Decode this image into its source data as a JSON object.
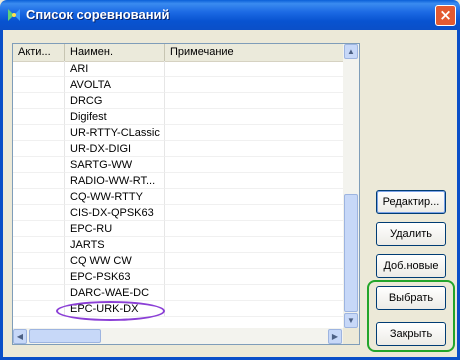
{
  "window": {
    "title": "Список соревнований",
    "close_label": "×"
  },
  "list": {
    "columns": [
      "Акти...",
      "Наимен.",
      "Примечание"
    ],
    "rows": [
      {
        "active": "",
        "name": "ARI",
        "note": ""
      },
      {
        "active": "",
        "name": "AVOLTA",
        "note": ""
      },
      {
        "active": "",
        "name": "DRCG",
        "note": ""
      },
      {
        "active": "",
        "name": "Digifest",
        "note": ""
      },
      {
        "active": "",
        "name": "UR-RTTY-CLassic",
        "note": ""
      },
      {
        "active": "",
        "name": "UR-DX-DIGI",
        "note": ""
      },
      {
        "active": "",
        "name": "SARTG-WW",
        "note": ""
      },
      {
        "active": "",
        "name": "RADIO-WW-RT...",
        "note": ""
      },
      {
        "active": "",
        "name": "CQ-WW-RTTY",
        "note": ""
      },
      {
        "active": "",
        "name": "CIS-DX-QPSK63",
        "note": ""
      },
      {
        "active": "",
        "name": "EPC-RU",
        "note": ""
      },
      {
        "active": "",
        "name": "JARTS",
        "note": ""
      },
      {
        "active": "",
        "name": "CQ WW CW",
        "note": ""
      },
      {
        "active": "",
        "name": "EPC-PSK63",
        "note": ""
      },
      {
        "active": "",
        "name": "DARC-WAE-DC",
        "note": ""
      },
      {
        "active": "",
        "name": "EPC-URK-DX",
        "note": ""
      }
    ],
    "scroll_up": "▲",
    "scroll_down": "▼",
    "scroll_left": "◀",
    "scroll_right": "▶"
  },
  "buttons": {
    "edit": "Редактир...",
    "delete": "Удалить",
    "add_new": "Доб.новые",
    "select": "Выбрать",
    "close": "Закрыть"
  },
  "colors": {
    "highlight_green": "#22a52b",
    "highlight_purple": "#8b3fd6",
    "title_blue": "#0a5fd8"
  }
}
